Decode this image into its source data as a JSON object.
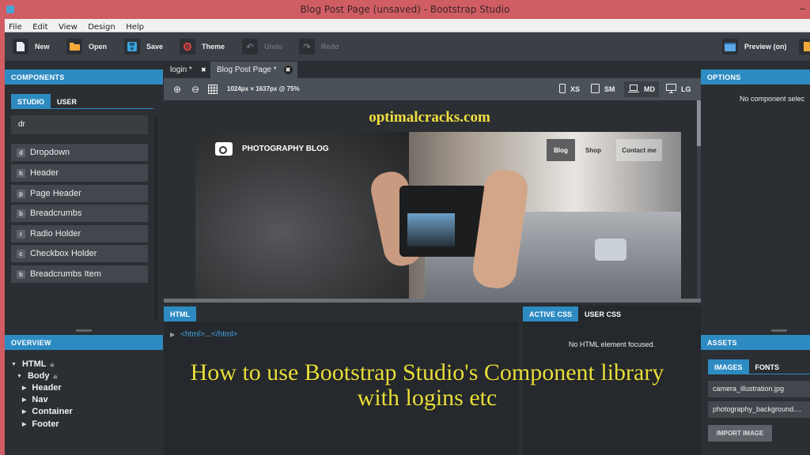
{
  "window": {
    "title": "Blog Post Page (unsaved) - Bootstrap Studio",
    "minimize": "–"
  },
  "menu": [
    "File",
    "Edit",
    "View",
    "Design",
    "Help"
  ],
  "toolbar": {
    "new": "New",
    "open": "Open",
    "save": "Save",
    "theme": "Theme",
    "undo": "Undo",
    "redo": "Redo",
    "preview": "Preview (on)"
  },
  "components": {
    "header": "COMPONENTS",
    "tabs": [
      "STUDIO",
      "USER"
    ],
    "search_value": "dr",
    "items": [
      {
        "key": "d",
        "label": "Dropdown"
      },
      {
        "key": "h",
        "label": "Header"
      },
      {
        "key": "p",
        "label": "Page Header"
      },
      {
        "key": "b",
        "label": "Breadcrumbs"
      },
      {
        "key": "r",
        "label": "Radio Holder"
      },
      {
        "key": "c",
        "label": "Checkbox Holder"
      },
      {
        "key": "b",
        "label": "Breadcrumbs Item"
      }
    ]
  },
  "overview": {
    "header": "OVERVIEW",
    "tree": [
      {
        "label": "HTML",
        "expanded": true,
        "locked": true
      },
      {
        "label": "Body",
        "expanded": true,
        "locked": true
      },
      {
        "label": "Header"
      },
      {
        "label": "Nav"
      },
      {
        "label": "Container"
      },
      {
        "label": "Footer"
      }
    ]
  },
  "doc_tabs": [
    {
      "label": "login *"
    },
    {
      "label": "Blog Post Page *",
      "active": true
    }
  ],
  "canvas_toolbar": {
    "size_text": "1024px × 1637px @ 75%",
    "breakpoints": [
      {
        "label": "XS"
      },
      {
        "label": "SM"
      },
      {
        "label": "MD",
        "active": true
      },
      {
        "label": "LG"
      }
    ]
  },
  "preview": {
    "watermark": "optimalcracks.com",
    "brand": "PHOTOGRAPHY BLOG",
    "nav": [
      "Blog",
      "Shop",
      "Contact me"
    ]
  },
  "html_panel": {
    "tab": "HTML",
    "code_open": "<html>",
    "code_ellipsis": "...",
    "code_close": "</html>"
  },
  "css_panel": {
    "tabs": [
      "ACTIVE CSS",
      "USER CSS"
    ],
    "message": "No HTML element focused."
  },
  "options": {
    "header": "OPTIONS",
    "message": "No component selec"
  },
  "assets": {
    "header": "ASSETS",
    "tabs": [
      "IMAGES",
      "FONTS"
    ],
    "files": [
      "camera_illustration.jpg",
      "photography_background...."
    ],
    "import_button": "IMPORT IMAGE"
  },
  "caption": {
    "line1": "How to use Bootstrap Studio's Component library",
    "line2": "with logins etc"
  }
}
